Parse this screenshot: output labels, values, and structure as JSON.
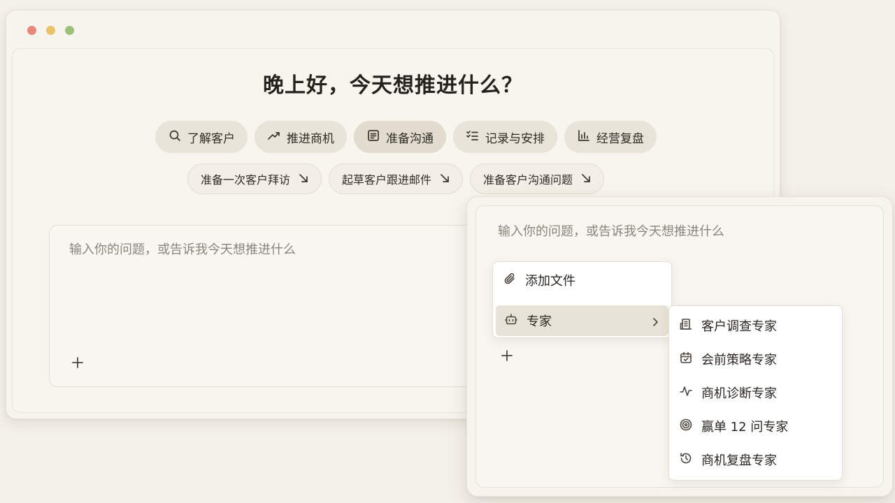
{
  "main_window": {
    "greeting": "晚上好，今天想推进什么？",
    "categories": [
      {
        "label": "了解客户",
        "icon": "search-icon"
      },
      {
        "label": "推进商机",
        "icon": "trend-up-icon"
      },
      {
        "label": "准备沟通",
        "icon": "document-icon"
      },
      {
        "label": "记录与安排",
        "icon": "checklist-icon"
      },
      {
        "label": "经营复盘",
        "icon": "bar-chart-icon"
      }
    ],
    "suggestions": [
      {
        "label": "准备一次客户拜访",
        "icon": "arrow-down-right-icon"
      },
      {
        "label": "起草客户跟进邮件",
        "icon": "arrow-down-right-icon"
      },
      {
        "label": "准备客户沟通问题",
        "icon": "arrow-down-right-icon"
      }
    ],
    "input": {
      "placeholder": "输入你的问题，或告诉我今天想推进什么"
    }
  },
  "overlay": {
    "input": {
      "placeholder": "输入你的问题，或告诉我今天想推进什么"
    },
    "menu": {
      "items": [
        {
          "label": "添加文件",
          "icon": "paperclip-icon"
        },
        {
          "label": "专家",
          "icon": "robot-icon",
          "has_submenu": true
        }
      ]
    },
    "submenu": {
      "items": [
        {
          "label": "客户调查专家",
          "icon": "building-icon"
        },
        {
          "label": "会前策略专家",
          "icon": "calendar-check-icon"
        },
        {
          "label": "商机诊断专家",
          "icon": "pulse-icon"
        },
        {
          "label": "赢单 12 问专家",
          "icon": "target-icon"
        },
        {
          "label": "商机复盘专家",
          "icon": "history-icon"
        }
      ]
    }
  },
  "colors": {
    "background": "#f4f1ea",
    "chip": "#e9e4d9",
    "highlight": "#e8e3d8"
  }
}
